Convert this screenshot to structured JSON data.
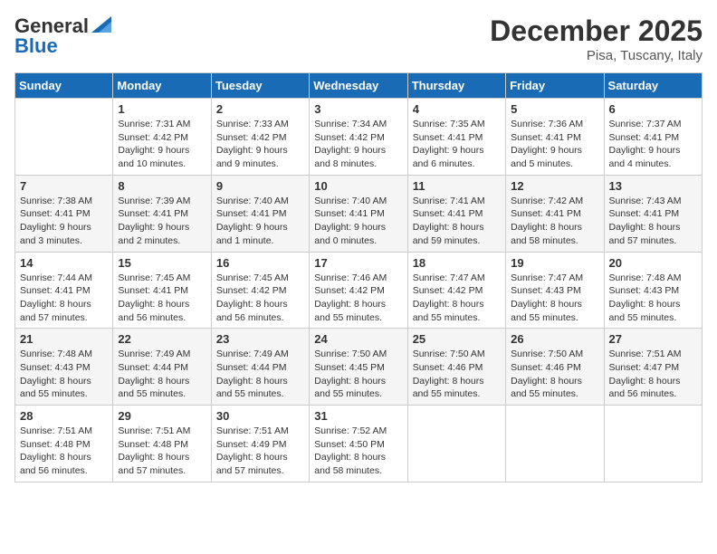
{
  "header": {
    "logo_general": "General",
    "logo_blue": "Blue",
    "month": "December 2025",
    "location": "Pisa, Tuscany, Italy"
  },
  "weekdays": [
    "Sunday",
    "Monday",
    "Tuesday",
    "Wednesday",
    "Thursday",
    "Friday",
    "Saturday"
  ],
  "weeks": [
    [
      {
        "day": "",
        "text": ""
      },
      {
        "day": "1",
        "text": "Sunrise: 7:31 AM\nSunset: 4:42 PM\nDaylight: 9 hours\nand 10 minutes."
      },
      {
        "day": "2",
        "text": "Sunrise: 7:33 AM\nSunset: 4:42 PM\nDaylight: 9 hours\nand 9 minutes."
      },
      {
        "day": "3",
        "text": "Sunrise: 7:34 AM\nSunset: 4:42 PM\nDaylight: 9 hours\nand 8 minutes."
      },
      {
        "day": "4",
        "text": "Sunrise: 7:35 AM\nSunset: 4:41 PM\nDaylight: 9 hours\nand 6 minutes."
      },
      {
        "day": "5",
        "text": "Sunrise: 7:36 AM\nSunset: 4:41 PM\nDaylight: 9 hours\nand 5 minutes."
      },
      {
        "day": "6",
        "text": "Sunrise: 7:37 AM\nSunset: 4:41 PM\nDaylight: 9 hours\nand 4 minutes."
      }
    ],
    [
      {
        "day": "7",
        "text": "Sunrise: 7:38 AM\nSunset: 4:41 PM\nDaylight: 9 hours\nand 3 minutes."
      },
      {
        "day": "8",
        "text": "Sunrise: 7:39 AM\nSunset: 4:41 PM\nDaylight: 9 hours\nand 2 minutes."
      },
      {
        "day": "9",
        "text": "Sunrise: 7:40 AM\nSunset: 4:41 PM\nDaylight: 9 hours\nand 1 minute."
      },
      {
        "day": "10",
        "text": "Sunrise: 7:40 AM\nSunset: 4:41 PM\nDaylight: 9 hours\nand 0 minutes."
      },
      {
        "day": "11",
        "text": "Sunrise: 7:41 AM\nSunset: 4:41 PM\nDaylight: 8 hours\nand 59 minutes."
      },
      {
        "day": "12",
        "text": "Sunrise: 7:42 AM\nSunset: 4:41 PM\nDaylight: 8 hours\nand 58 minutes."
      },
      {
        "day": "13",
        "text": "Sunrise: 7:43 AM\nSunset: 4:41 PM\nDaylight: 8 hours\nand 57 minutes."
      }
    ],
    [
      {
        "day": "14",
        "text": "Sunrise: 7:44 AM\nSunset: 4:41 PM\nDaylight: 8 hours\nand 57 minutes."
      },
      {
        "day": "15",
        "text": "Sunrise: 7:45 AM\nSunset: 4:41 PM\nDaylight: 8 hours\nand 56 minutes."
      },
      {
        "day": "16",
        "text": "Sunrise: 7:45 AM\nSunset: 4:42 PM\nDaylight: 8 hours\nand 56 minutes."
      },
      {
        "day": "17",
        "text": "Sunrise: 7:46 AM\nSunset: 4:42 PM\nDaylight: 8 hours\nand 55 minutes."
      },
      {
        "day": "18",
        "text": "Sunrise: 7:47 AM\nSunset: 4:42 PM\nDaylight: 8 hours\nand 55 minutes."
      },
      {
        "day": "19",
        "text": "Sunrise: 7:47 AM\nSunset: 4:43 PM\nDaylight: 8 hours\nand 55 minutes."
      },
      {
        "day": "20",
        "text": "Sunrise: 7:48 AM\nSunset: 4:43 PM\nDaylight: 8 hours\nand 55 minutes."
      }
    ],
    [
      {
        "day": "21",
        "text": "Sunrise: 7:48 AM\nSunset: 4:43 PM\nDaylight: 8 hours\nand 55 minutes."
      },
      {
        "day": "22",
        "text": "Sunrise: 7:49 AM\nSunset: 4:44 PM\nDaylight: 8 hours\nand 55 minutes."
      },
      {
        "day": "23",
        "text": "Sunrise: 7:49 AM\nSunset: 4:44 PM\nDaylight: 8 hours\nand 55 minutes."
      },
      {
        "day": "24",
        "text": "Sunrise: 7:50 AM\nSunset: 4:45 PM\nDaylight: 8 hours\nand 55 minutes."
      },
      {
        "day": "25",
        "text": "Sunrise: 7:50 AM\nSunset: 4:46 PM\nDaylight: 8 hours\nand 55 minutes."
      },
      {
        "day": "26",
        "text": "Sunrise: 7:50 AM\nSunset: 4:46 PM\nDaylight: 8 hours\nand 55 minutes."
      },
      {
        "day": "27",
        "text": "Sunrise: 7:51 AM\nSunset: 4:47 PM\nDaylight: 8 hours\nand 56 minutes."
      }
    ],
    [
      {
        "day": "28",
        "text": "Sunrise: 7:51 AM\nSunset: 4:48 PM\nDaylight: 8 hours\nand 56 minutes."
      },
      {
        "day": "29",
        "text": "Sunrise: 7:51 AM\nSunset: 4:48 PM\nDaylight: 8 hours\nand 57 minutes."
      },
      {
        "day": "30",
        "text": "Sunrise: 7:51 AM\nSunset: 4:49 PM\nDaylight: 8 hours\nand 57 minutes."
      },
      {
        "day": "31",
        "text": "Sunrise: 7:52 AM\nSunset: 4:50 PM\nDaylight: 8 hours\nand 58 minutes."
      },
      {
        "day": "",
        "text": ""
      },
      {
        "day": "",
        "text": ""
      },
      {
        "day": "",
        "text": ""
      }
    ]
  ]
}
